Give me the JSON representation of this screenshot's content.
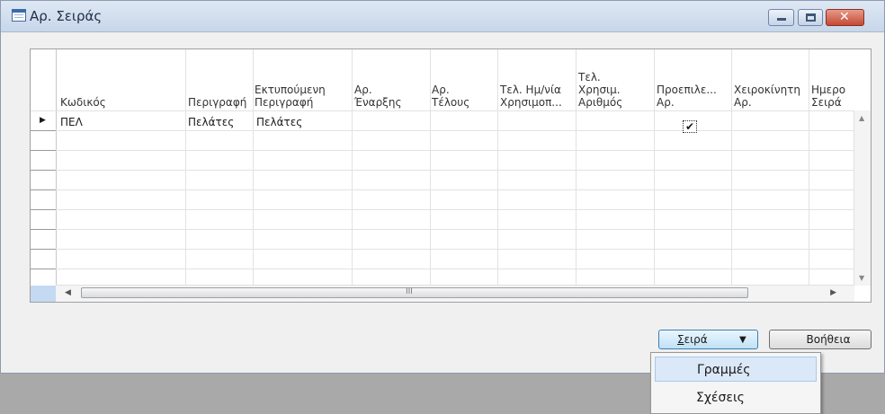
{
  "window": {
    "title": "Αρ. Σειράς",
    "close_glyph": "✕"
  },
  "grid": {
    "columns": [
      "Κωδικός",
      "Περιγραφή",
      "Εκτυπούμενη\nΠεριγραφή",
      "Αρ.\nΈναρξης",
      "Αρ.\nΤέλους",
      "Τελ. Ημ/νία\nΧρησιμοπ...",
      "Τελ.\nΧρησιμ.\nΑριθμός",
      "Προεπιλε...\nΑρ.",
      "Χειροκίνητη\nΑρ.",
      "Ημερο\nΣειρά"
    ],
    "rows": [
      {
        "code": "ΠΕΛ",
        "description": "Πελάτες",
        "printed_description": "Πελάτες",
        "default_nos": true
      }
    ],
    "check_glyph": "✔",
    "row_marker": "▶",
    "scroll_up": "▲",
    "scroll_down": "▼",
    "scroll_left": "◀",
    "scroll_right": "▶",
    "thumb_grip": "III"
  },
  "buttons": {
    "series_prefix": "Σ",
    "series_rest": "ειρά",
    "dropdown_glyph": "▼",
    "help": "Βοήθεια"
  },
  "menu": {
    "items": [
      "Γραμμές",
      "Σχέσεις"
    ]
  }
}
